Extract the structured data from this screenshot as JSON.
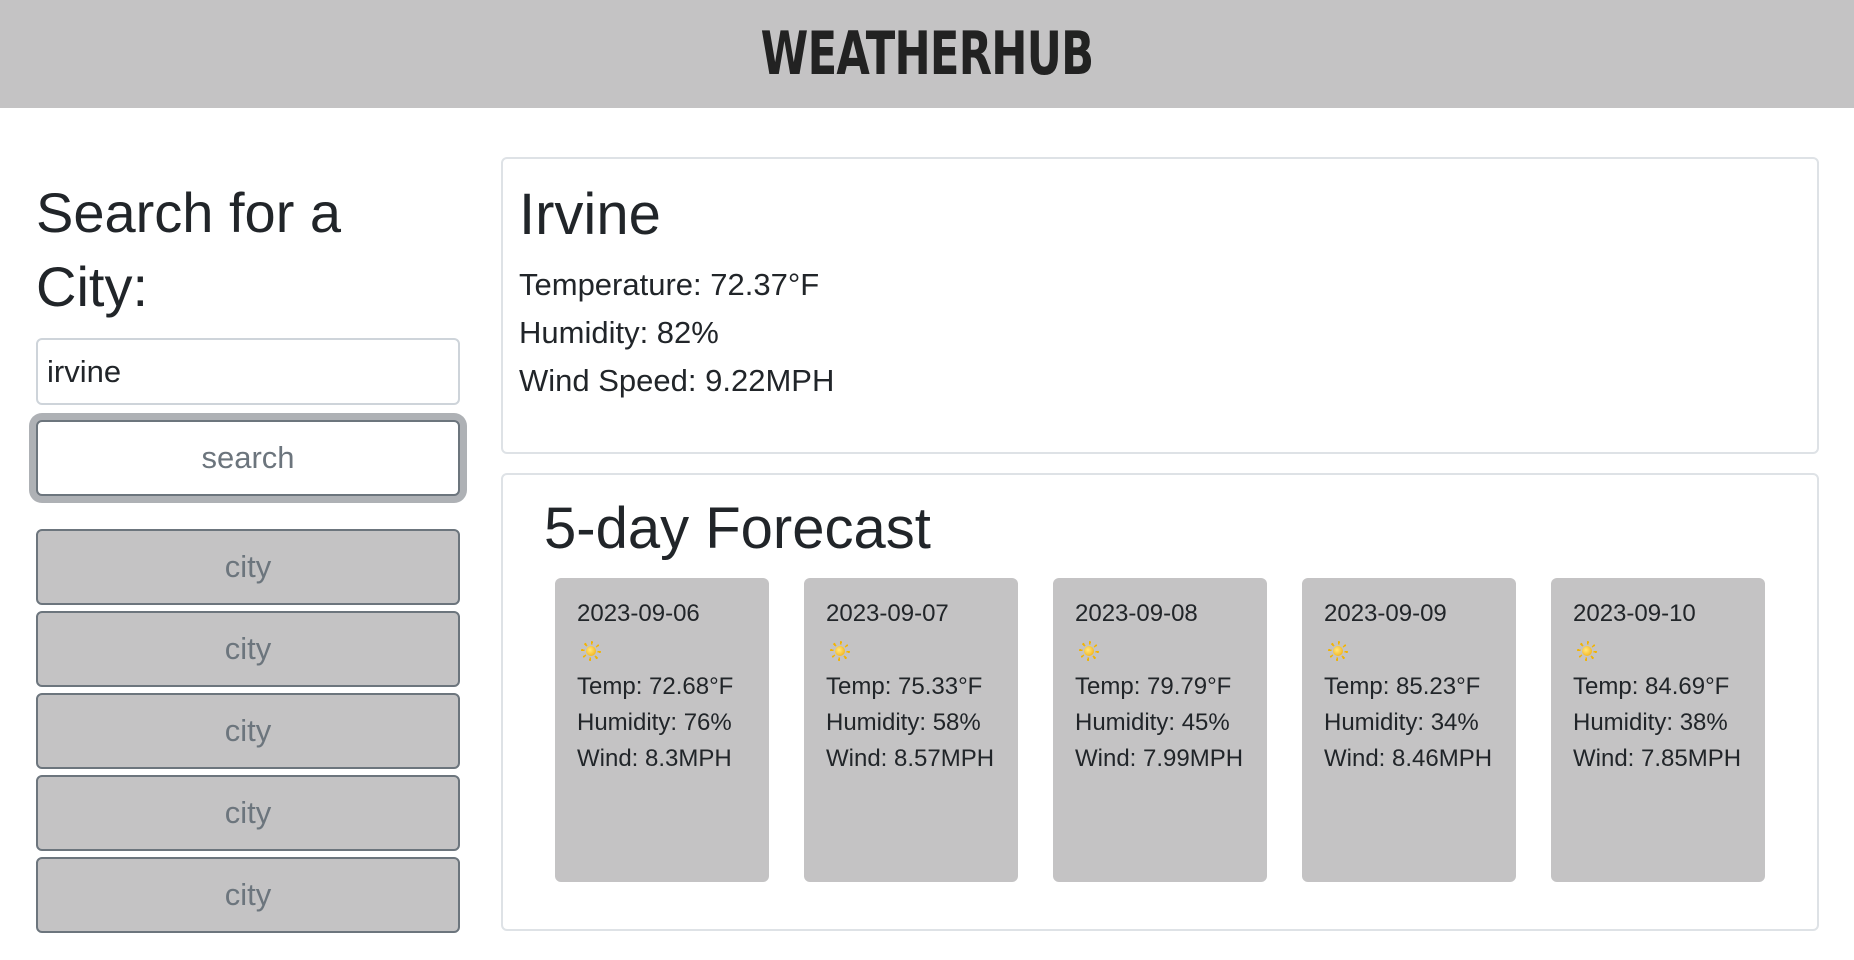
{
  "header": {
    "title": "WeatherHub"
  },
  "sidebar": {
    "title": "Search for a City:",
    "search_value": "irvine",
    "search_button": "search",
    "history": [
      "city",
      "city",
      "city",
      "city",
      "city"
    ]
  },
  "current": {
    "city": "Irvine",
    "temperature": "Temperature: 72.37°F",
    "humidity": "Humidity: 82%",
    "wind": "Wind Speed: 9.22MPH"
  },
  "forecast": {
    "title": "5-day Forecast",
    "days": [
      {
        "date": "2023-09-06",
        "icon": "sun-icon",
        "temp": "Temp: 72.68°F",
        "humidity": "Humidity: 76%",
        "wind": "Wind: 8.3MPH"
      },
      {
        "date": "2023-09-07",
        "icon": "sun-icon",
        "temp": "Temp: 75.33°F",
        "humidity": "Humidity: 58%",
        "wind": "Wind: 8.57MPH"
      },
      {
        "date": "2023-09-08",
        "icon": "sun-icon",
        "temp": "Temp: 79.79°F",
        "humidity": "Humidity: 45%",
        "wind": "Wind: 7.99MPH"
      },
      {
        "date": "2023-09-09",
        "icon": "sun-icon",
        "temp": "Temp: 85.23°F",
        "humidity": "Humidity: 34%",
        "wind": "Wind: 8.46MPH"
      },
      {
        "date": "2023-09-10",
        "icon": "sun-icon",
        "temp": "Temp: 84.69°F",
        "humidity": "Humidity: 38%",
        "wind": "Wind: 7.85MPH"
      }
    ]
  },
  "colors": {
    "header_bg": "#c4c3c4",
    "card_bg": "#c4c3c4",
    "muted_text": "#6c757d"
  }
}
